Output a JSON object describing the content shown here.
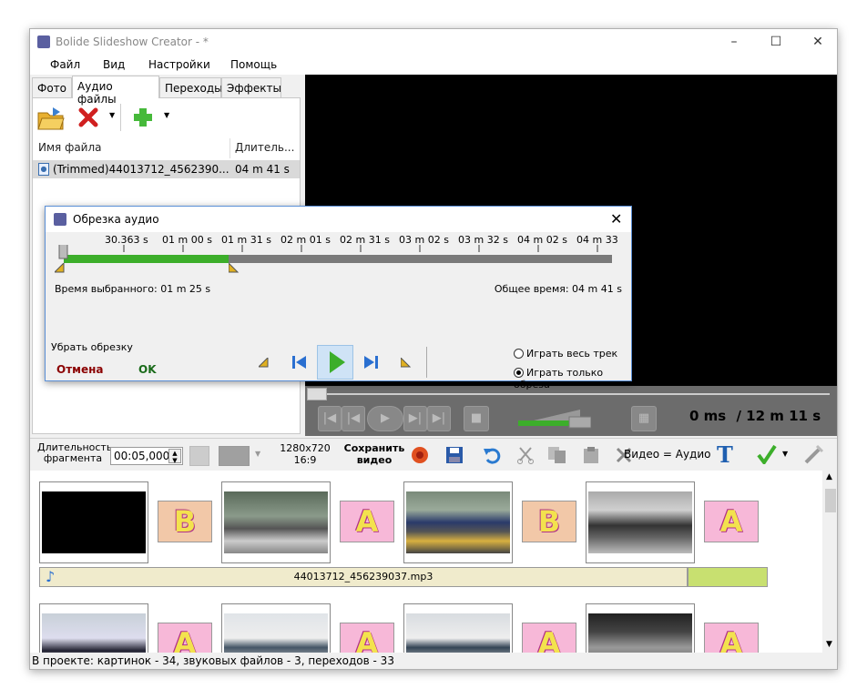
{
  "window": {
    "title": "Bolide Slideshow Creator - *"
  },
  "menu": [
    "Файл",
    "Вид",
    "Настройки",
    "Помощь"
  ],
  "tabs": [
    "Фото",
    "Аудио файлы",
    "Переходы",
    "Эффекты"
  ],
  "file_list": {
    "col_name": "Имя файла",
    "col_length": "Длитель...",
    "rows": [
      {
        "name": "(Trimmed)44013712_4562390...",
        "length": "04 m 41 s"
      }
    ]
  },
  "dialog": {
    "title": "Обрезка аудио",
    "ticks": [
      "30.363 s",
      "01 m 00 s",
      "01 m 31 s",
      "02 m 01 s",
      "02 m 31 s",
      "03 m 02 s",
      "03 m 32 s",
      "04 m 02 s",
      "04 m 33"
    ],
    "selected_time": "Время выбранного: 01 m 25 s",
    "total_time": "Общее время: 04 m 41 s",
    "remove_trim": "Убрать обрезку",
    "cancel": "Отмена",
    "ok": "OK",
    "play_all": "Играть весь трек",
    "play_trimmed": "Играть только обреза",
    "selected_mode": "play_trimmed",
    "selection_fraction": 0.3
  },
  "player": {
    "time": "0 ms",
    "total": "/ 12 m 11 s",
    "progress": 0
  },
  "bottom_toolbar": {
    "fragment_label": "Длительность фрагмента",
    "fragment_value": "00:05,000",
    "resolution": "1280x720",
    "aspect": "16:9",
    "save_video": "Сохранить видео",
    "video_audio": "Видео = Аудио"
  },
  "storyboard": {
    "audio_track": "44013712_456239037.mp3",
    "transitions_row1": [
      "B",
      "A",
      "B",
      "A"
    ],
    "transitions_row2": [
      "A",
      "A",
      "A",
      "A"
    ]
  },
  "status": "В проекте: картинок - 34, звуковых файлов - 3, переходов - 33",
  "colors": {
    "accent_green": "#3cae2a",
    "dark_red": "#8b0000",
    "ok_green": "#1a6b1a"
  }
}
